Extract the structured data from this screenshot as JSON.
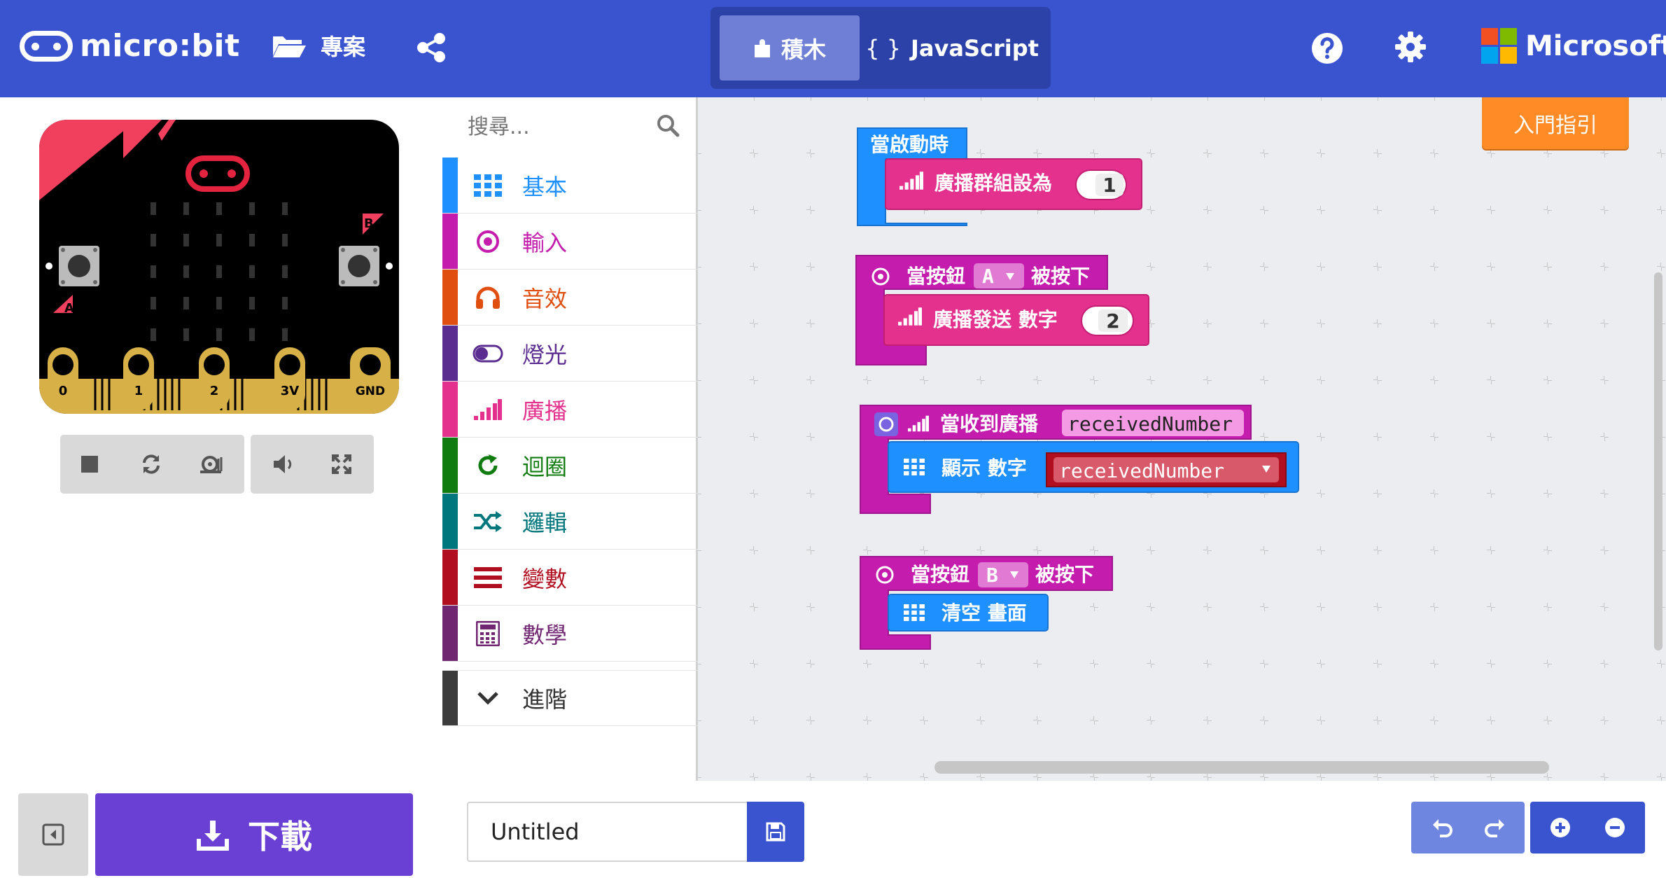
{
  "header": {
    "brand": "micro:bit",
    "projects_label": "專案",
    "blocks_tab": "積木",
    "javascript_tab": "JavaScript",
    "javascript_prefix": "{ }",
    "microsoft": "Microsoft",
    "ms_colors": [
      "#f25022",
      "#7fba00",
      "#00a4ef",
      "#ffb900"
    ]
  },
  "simulator": {
    "pins": [
      "0",
      "1",
      "2",
      "3V",
      "GND"
    ],
    "button_a": "A",
    "button_b": "B"
  },
  "toolbox": {
    "search_placeholder": "搜尋...",
    "categories": [
      {
        "label": "基本",
        "color": "#1e90ff",
        "icon": "grid-icon"
      },
      {
        "label": "輸入",
        "color": "#c41cad",
        "icon": "target-icon"
      },
      {
        "label": "音效",
        "color": "#e04e10",
        "icon": "headphones-icon"
      },
      {
        "label": "燈光",
        "color": "#5c2d91",
        "icon": "toggle-icon"
      },
      {
        "label": "廣播",
        "color": "#e3318d",
        "icon": "signal-icon"
      },
      {
        "label": "迴圈",
        "color": "#107c10",
        "icon": "loop-icon"
      },
      {
        "label": "邏輯",
        "color": "#00777c",
        "icon": "shuffle-icon"
      },
      {
        "label": "變數",
        "color": "#b10f20",
        "icon": "list-icon"
      },
      {
        "label": "數學",
        "color": "#712672",
        "icon": "calculator-icon"
      }
    ],
    "advanced": {
      "label": "進階",
      "color": "#3c3c3c"
    }
  },
  "workspace": {
    "getting_started": "入門指引",
    "blocks": {
      "on_start": "當啟動時",
      "set_group": "廣播群組設為",
      "set_group_value": "1",
      "on_button": "當按鈕",
      "pressed": "被按下",
      "button_a": "A",
      "send_number": "廣播發送 數字",
      "send_value": "2",
      "on_received": "當收到廣播",
      "received_var": "receivedNumber",
      "show_number": "顯示 數字",
      "button_b": "B",
      "clear_screen": "清空 畫面"
    }
  },
  "footer": {
    "download_label": "下載",
    "project_name": "Untitled"
  }
}
